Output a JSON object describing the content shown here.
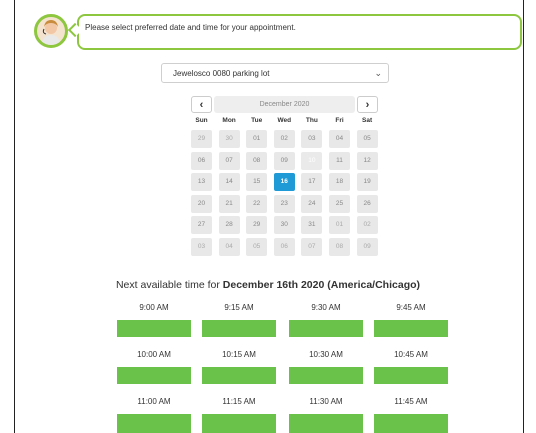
{
  "chat": {
    "message": "Please select preferred date and time for your appointment."
  },
  "location": {
    "selected": "Jewelosco 0080 parking lot"
  },
  "calendar": {
    "prev_label": "‹",
    "next_label": "›",
    "month_label": "December 2020",
    "weekdays": [
      "Sun",
      "Mon",
      "Tue",
      "Wed",
      "Thu",
      "Fri",
      "Sat"
    ],
    "weeks": [
      [
        "29",
        "30",
        "01",
        "02",
        "03",
        "04",
        "05"
      ],
      [
        "06",
        "07",
        "08",
        "09",
        "10",
        "11",
        "12"
      ],
      [
        "13",
        "14",
        "15",
        "16",
        "17",
        "18",
        "19"
      ],
      [
        "20",
        "21",
        "22",
        "23",
        "24",
        "25",
        "26"
      ],
      [
        "27",
        "28",
        "29",
        "30",
        "31",
        "01",
        "02"
      ],
      [
        "03",
        "04",
        "05",
        "06",
        "07",
        "08",
        "09"
      ]
    ],
    "selected_day": "16"
  },
  "availability": {
    "prefix": "Next available time for ",
    "date_label": "December 16th 2020 (America/Chicago)",
    "times": [
      [
        "9:00 AM",
        "9:15 AM",
        "9:30 AM",
        "9:45 AM"
      ],
      [
        "10:00 AM",
        "10:15 AM",
        "10:30 AM",
        "10:45 AM"
      ],
      [
        "11:00 AM",
        "11:15 AM",
        "11:30 AM",
        "11:45 AM"
      ]
    ]
  },
  "colors": {
    "accent_green": "#8dc63f",
    "slot_green": "#6bc24a",
    "selected_blue": "#1f9ad6"
  }
}
